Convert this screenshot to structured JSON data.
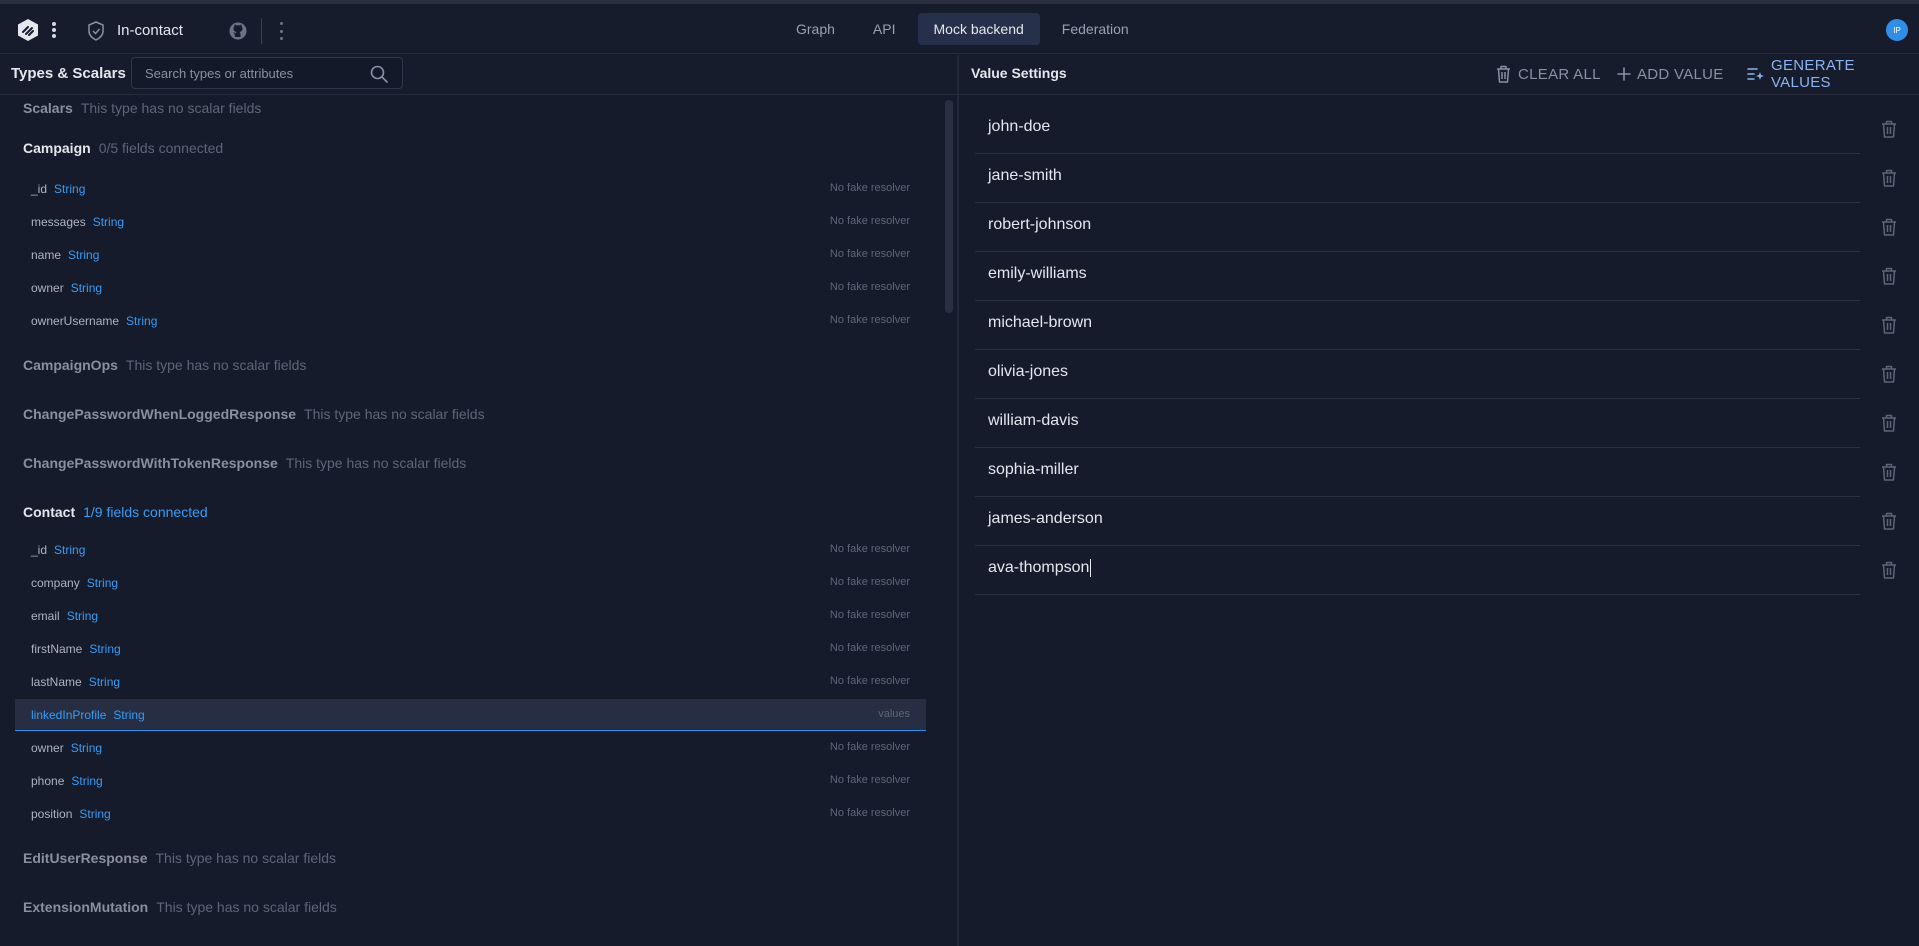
{
  "project": {
    "name": "In-contact"
  },
  "nav": {
    "tabs": [
      "Graph",
      "API",
      "Mock backend",
      "Federation"
    ],
    "active": "Mock backend"
  },
  "user": {
    "initials": "IP"
  },
  "left_panel": {
    "title": "Types & Scalars",
    "search_placeholder": "Search types or attributes",
    "types": [
      {
        "name": "Scalars",
        "note": "This type has no scalar fields",
        "fields": []
      },
      {
        "name": "Campaign",
        "note": "0/5 fields connected",
        "fields": [
          {
            "name": "_id",
            "type": "String",
            "status": "No fake resolver"
          },
          {
            "name": "messages",
            "type": "String",
            "status": "No fake resolver"
          },
          {
            "name": "name",
            "type": "String",
            "status": "No fake resolver"
          },
          {
            "name": "owner",
            "type": "String",
            "status": "No fake resolver"
          },
          {
            "name": "ownerUsername",
            "type": "String",
            "status": "No fake resolver"
          }
        ]
      },
      {
        "name": "CampaignOps",
        "note": "This type has no scalar fields",
        "fields": []
      },
      {
        "name": "ChangePasswordWhenLoggedResponse",
        "note": "This type has no scalar fields",
        "fields": []
      },
      {
        "name": "ChangePasswordWithTokenResponse",
        "note": "This type has no scalar fields",
        "fields": []
      },
      {
        "name": "Contact",
        "note": "1/9 fields connected",
        "fields": [
          {
            "name": "_id",
            "type": "String",
            "status": "No fake resolver"
          },
          {
            "name": "company",
            "type": "String",
            "status": "No fake resolver"
          },
          {
            "name": "email",
            "type": "String",
            "status": "No fake resolver"
          },
          {
            "name": "firstName",
            "type": "String",
            "status": "No fake resolver"
          },
          {
            "name": "lastName",
            "type": "String",
            "status": "No fake resolver"
          },
          {
            "name": "linkedInProfile",
            "type": "String",
            "status": "values"
          },
          {
            "name": "owner",
            "type": "String",
            "status": "No fake resolver"
          },
          {
            "name": "phone",
            "type": "String",
            "status": "No fake resolver"
          },
          {
            "name": "position",
            "type": "String",
            "status": "No fake resolver"
          }
        ]
      },
      {
        "name": "EditUserResponse",
        "note": "This type has no scalar fields",
        "fields": []
      },
      {
        "name": "ExtensionMutation",
        "note": "This type has no scalar fields",
        "fields": []
      }
    ]
  },
  "right_panel": {
    "title": "Value Settings",
    "actions": {
      "clear_all": "CLEAR ALL",
      "add_value": "ADD VALUE",
      "generate": "GENERATE VALUES"
    },
    "values": [
      "john-doe",
      "jane-smith",
      "robert-johnson",
      "emily-williams",
      "michael-brown",
      "olivia-jones",
      "william-davis",
      "sophia-miller",
      "james-anderson",
      "ava-thompson"
    ]
  },
  "colors": {
    "accent": "#3a9cf2",
    "background": "#161b2c",
    "selected_row": "#272d42"
  }
}
